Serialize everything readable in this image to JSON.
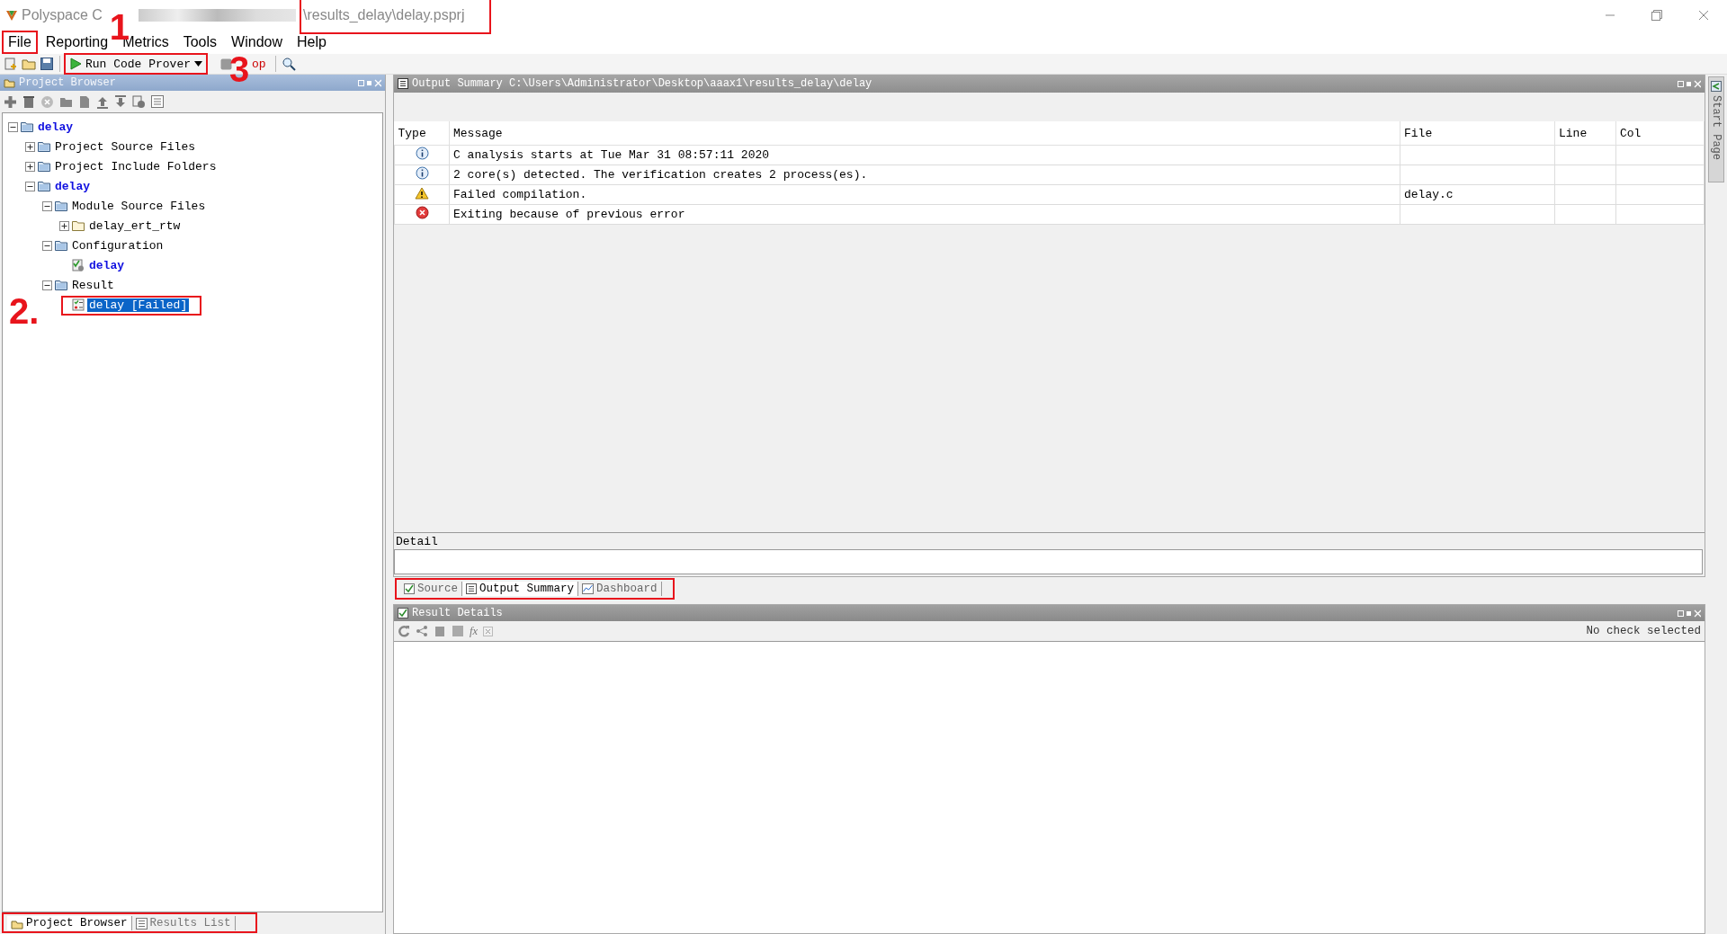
{
  "window": {
    "title_start": "Polyspace C",
    "title_end": "\\results_delay\\delay.psprj",
    "title_end_highlighted": true
  },
  "menu": [
    {
      "label": "File",
      "highlighted": true,
      "marker": "1"
    },
    {
      "label": "Reporting",
      "highlighted": false
    },
    {
      "label": "Metrics",
      "highlighted": false
    },
    {
      "label": "Tools",
      "highlighted": false
    },
    {
      "label": "Window",
      "highlighted": false
    },
    {
      "label": "Help",
      "highlighted": false
    }
  ],
  "toolbar": {
    "run_button": {
      "label": "Run Code Prover",
      "highlighted": true,
      "marker": "3"
    },
    "stop_button": {
      "label": "op"
    }
  },
  "project_browser": {
    "title": "Project Browser",
    "tree": [
      {
        "label": "delay",
        "kind": "project",
        "expanded": true,
        "selected": false,
        "children": [
          {
            "label": "Project Source Files",
            "kind": "folder",
            "expanded": false,
            "selected": false
          },
          {
            "label": "Project Include Folders",
            "kind": "folder",
            "expanded": false,
            "selected": false
          },
          {
            "label": "delay",
            "kind": "module",
            "expanded": true,
            "selected": false,
            "children": [
              {
                "label": "Module Source Files",
                "kind": "folder",
                "expanded": true,
                "selected": false,
                "children": [
                  {
                    "label": "delay_ert_rtw",
                    "kind": "plain-folder",
                    "expanded": false,
                    "selected": false
                  }
                ]
              },
              {
                "label": "Configuration",
                "kind": "folder",
                "expanded": true,
                "selected": false,
                "children": [
                  {
                    "label": "delay",
                    "kind": "config",
                    "selected": false
                  }
                ]
              },
              {
                "label": "Result",
                "kind": "folder",
                "expanded": true,
                "selected": false,
                "children": [
                  {
                    "label": "delay [Failed]",
                    "kind": "result",
                    "selected": true,
                    "highlighted": true,
                    "marker": "2."
                  }
                ]
              }
            ]
          }
        ]
      }
    ],
    "tabs": [
      {
        "label": "Project Browser",
        "selected": true
      },
      {
        "label": "Results List",
        "selected": false
      }
    ],
    "tabs_highlighted": true
  },
  "output_summary": {
    "title": "Output Summary C:\\Users\\Administrator\\Desktop\\aaax1\\results_delay\\delay",
    "columns": [
      "Type",
      "Message",
      "File",
      "Line",
      "Col"
    ],
    "rows": [
      {
        "kind": "info",
        "message": "C analysis starts at Tue Mar 31 08:57:11 2020"
      },
      {
        "kind": "info",
        "message": "2 core(s) detected. The verification creates 2 process(es)."
      },
      {
        "kind": "warning",
        "message": "Failed compilation.",
        "file": "delay.c"
      },
      {
        "kind": "error",
        "message": "Exiting because of previous error"
      }
    ],
    "detail_label": "Detail"
  },
  "center_tabs": [
    {
      "label": "Source",
      "selected": false
    },
    {
      "label": "Output Summary",
      "selected": true
    },
    {
      "label": "Dashboard",
      "selected": false
    }
  ],
  "center_tabs_highlighted": true,
  "result_details": {
    "title": "Result Details",
    "status": "No check selected",
    "function_button": "fx"
  },
  "side_tab": {
    "label": "Start Page"
  }
}
